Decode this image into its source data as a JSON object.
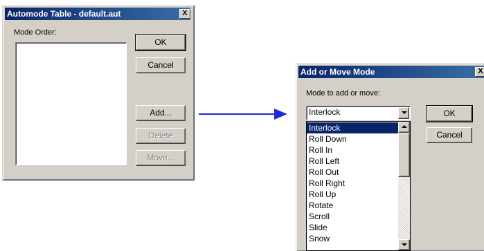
{
  "automode_dialog": {
    "title": "Automode Table - default.aut",
    "close_glyph": "X",
    "mode_order_label": "Mode Order:",
    "mode_order_items": [],
    "buttons": {
      "ok": "OK",
      "cancel": "Cancel",
      "add": "Add...",
      "delete": "Delete",
      "move": "Move..."
    }
  },
  "arrow": {
    "color": "#1f28d8"
  },
  "add_move_dialog": {
    "title": "Add or Move Mode",
    "close_glyph": "X",
    "prompt_label": "Mode to add or move:",
    "combo_value": "Interlock",
    "buttons": {
      "ok": "OK",
      "cancel": "Cancel"
    },
    "options": [
      "Interlock",
      "Roll Down",
      "Roll In",
      "Roll Left",
      "Roll Out",
      "Roll Right",
      "Roll Up",
      "Rotate",
      "Scroll",
      "Slide",
      "Snow"
    ],
    "selected_option": "Interlock"
  },
  "colors": {
    "titlebar_start": "#0a246a",
    "titlebar_end": "#3a6ea5",
    "dialog_face": "#d4d0c8",
    "selection": "#0a246a"
  }
}
